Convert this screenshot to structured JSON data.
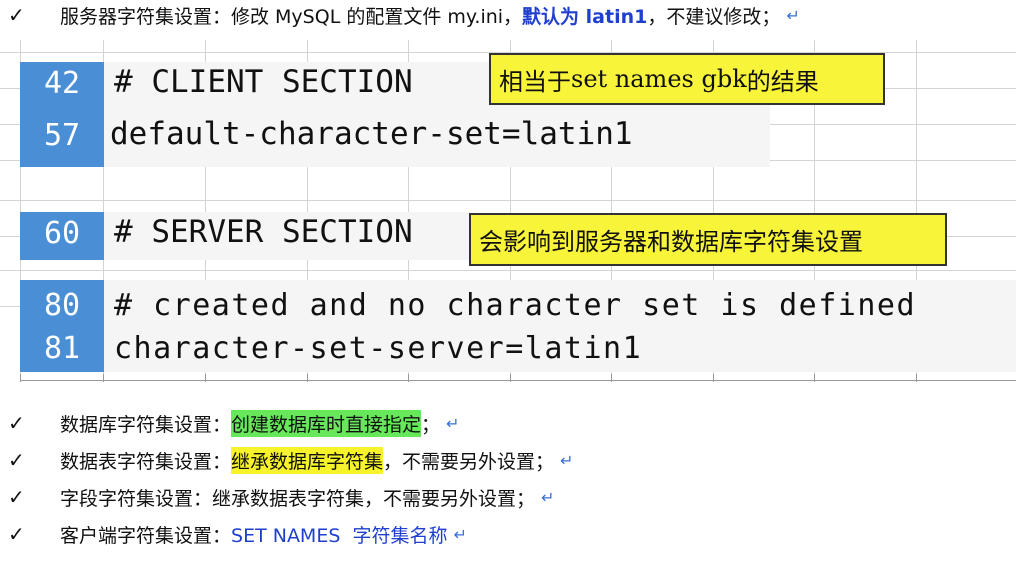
{
  "lines": {
    "top": {
      "check": "✓",
      "prefix": "服务器字符集设置：修改 MySQL 的配置文件 my.ini，",
      "highlight": "默认为 latin1",
      "suffix": "，不建议修改；"
    },
    "b1": {
      "check": "✓",
      "prefix": "数据库字符集设置：",
      "highlight": "创建数据库时直接指定",
      "suffix": "；"
    },
    "b2": {
      "check": "✓",
      "prefix": "数据表字符集设置：",
      "highlight": "继承数据库字符集",
      "suffix": "，不需要另外设置；"
    },
    "b3": {
      "check": "✓",
      "prefix": "字段字符集设置：继承数据表字符集，不需要另外设置；"
    },
    "b4": {
      "check": "✓",
      "prefix": "客户端字符集设置：",
      "highlight": "SET NAMES  字符集名称"
    }
  },
  "return_mark": "↵",
  "code": {
    "block1": {
      "num1": "42",
      "line1": "# CLIENT SECTION",
      "num2": "57",
      "line2": "default-character-set=latin1"
    },
    "block2": {
      "num1": "60",
      "line1": "# SERVER SECTION"
    },
    "block3": {
      "num1": "80",
      "line1": "# created and no character set is defined",
      "num2": "81",
      "line2": "character-set-server=latin1"
    }
  },
  "notes": {
    "note1": {
      "pre": "相当于",
      "mono": "set names gbk",
      "post": "的结果"
    },
    "note2": "会影响到服务器和数据库字符集设置"
  }
}
